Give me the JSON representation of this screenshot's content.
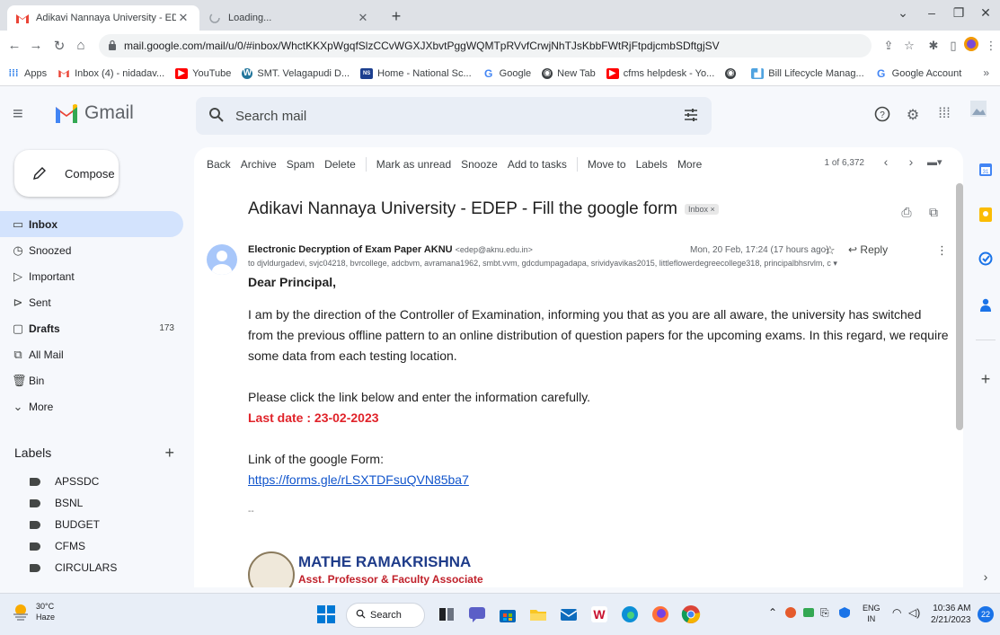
{
  "browser": {
    "tabs": [
      {
        "label": "Adikavi Nannaya University - EDE",
        "active": true
      },
      {
        "label": "Loading...",
        "active": false
      }
    ],
    "url": "mail.google.com/mail/u/0/#inbox/WhctKKXpWgqfSlzCCvWGXJXbvtPggWQMTpRVvfCrwjNhTJsKbbFWtRjFtpdjcmbSDftgjSV",
    "bookmarks": [
      {
        "label": "Apps",
        "icon": "apps-grid-icon"
      },
      {
        "label": "Inbox (4) - nidadav...",
        "icon": "gmail-icon"
      },
      {
        "label": "YouTube",
        "icon": "youtube-icon"
      },
      {
        "label": "SMT. Velagapudi D...",
        "icon": "wordpress-icon"
      },
      {
        "label": "Home - National Sc...",
        "icon": "nsp-icon"
      },
      {
        "label": "Google",
        "icon": "google-icon"
      },
      {
        "label": "New Tab",
        "icon": "chrome-icon"
      },
      {
        "label": "cfms helpdesk - Yo...",
        "icon": "youtube-icon"
      },
      {
        "label": "",
        "icon": "globe-icon"
      },
      {
        "label": "Bill Lifecycle Manag...",
        "icon": "chart-icon"
      },
      {
        "label": "Google Account",
        "icon": "google-icon"
      }
    ],
    "bookmarks_more": "»"
  },
  "gmail": {
    "logo_text": "Gmail",
    "search_placeholder": "Search mail",
    "compose_label": "Compose",
    "nav": [
      {
        "label": "Inbox",
        "icon": "inbox-icon",
        "count": "",
        "active": true,
        "bold": true
      },
      {
        "label": "Snoozed",
        "icon": "clock-icon",
        "count": "",
        "active": false,
        "bold": false
      },
      {
        "label": "Important",
        "icon": "important-icon",
        "count": "",
        "active": false,
        "bold": false
      },
      {
        "label": "Sent",
        "icon": "send-icon",
        "count": "",
        "active": false,
        "bold": false
      },
      {
        "label": "Drafts",
        "icon": "draft-icon",
        "count": "173",
        "active": false,
        "bold": true
      },
      {
        "label": "All Mail",
        "icon": "all-mail-icon",
        "count": "",
        "active": false,
        "bold": false
      },
      {
        "label": "Bin",
        "icon": "trash-icon",
        "count": "",
        "active": false,
        "bold": false
      },
      {
        "label": "More",
        "icon": "chevron-down-icon",
        "count": "",
        "active": false,
        "bold": false
      }
    ],
    "labels_heading": "Labels",
    "labels": [
      "APSSDC",
      "BSNL",
      "BUDGET",
      "CFMS",
      "CIRCULARS"
    ],
    "actions": [
      "Back",
      "Archive",
      "Spam",
      "Delete",
      "Mark as unread",
      "Snooze",
      "Add to tasks",
      "Move to",
      "Labels",
      "More"
    ],
    "pager": "1 of 6,372",
    "email": {
      "subject": "Adikavi Nannaya University - EDEP - Fill the google form",
      "badge": "Inbox ×",
      "sender_name": "Electronic Decryption of Exam Paper AKNU",
      "sender_email": "<edep@aknu.edu.in>",
      "recipients": "to djvldurgadevi, svjc04218, bvrcollege, adcbvm, avramana1962, smbt.vvm, gdcdumpagadapa, srividyavikas2015, littleflowerdegreecollege318, principalbhsrvlm, c ▾",
      "datetime": "Mon, 20 Feb, 17:24 (17 hours ago)",
      "reply_label": "Reply",
      "greeting": "Dear Principal,",
      "paragraph1": "I am by the direction of the Controller of Examination, informing you that as you are all aware, the university has switched from the previous offline pattern to an online distribution of question papers for the upcoming exams. In this regard, we require some data from each testing location.",
      "paragraph2": "Please click the link below and enter the information carefully.",
      "deadline": "Last date : 23-02-2023",
      "link_label": "Link of the google Form:",
      "link": "https://forms.gle/rLSXTDFsuQVN85ba7",
      "dash": "--",
      "signature_name": "MATHE RAMAKRISHNA",
      "signature_title": "Asst. Professor & Faculty Associate"
    }
  },
  "taskbar": {
    "temperature": "30°C",
    "weather": "Haze",
    "search_label": "Search",
    "lang_top": "ENG",
    "lang_bottom": "IN",
    "time": "10:36 AM",
    "date": "2/21/2023",
    "notifications": "22"
  },
  "colors": {
    "gmail_red": "#ea4335",
    "inbox_active": "#d3e3fd",
    "deadline_red": "#e0232a",
    "link_blue": "#1155cc",
    "signature_blue": "#1f3c8a"
  }
}
